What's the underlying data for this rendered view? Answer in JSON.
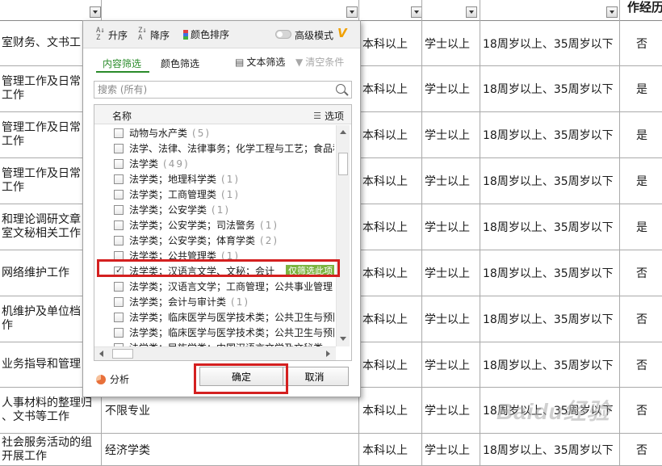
{
  "sheet": {
    "header_right": "作经历",
    "rows": [
      {
        "a": "室财务、文书工",
        "d": "本科以上",
        "e": "学士以上",
        "f": "18周岁以上、35周岁以下",
        "g": "否"
      },
      {
        "a": "管理工作及日常\n工作",
        "d": "本科以上",
        "e": "学士以上",
        "f": "18周岁以上、35周岁以下",
        "g": "是"
      },
      {
        "a": "管理工作及日常\n工作",
        "d": "本科以上",
        "e": "学士以上",
        "f": "18周岁以上、35周岁以下",
        "g": "是"
      },
      {
        "a": "管理工作及日常\n工作",
        "d": "本科以上",
        "e": "学士以上",
        "f": "18周岁以上、35周岁以下",
        "g": "是"
      },
      {
        "a": "和理论调研文章\n室文秘相关工作",
        "d": "本科以上",
        "e": "学士以上",
        "f": "18周岁以上、35周岁以下",
        "g": "是"
      },
      {
        "a": "网络维护工作",
        "d": "本科以上",
        "e": "学士以上",
        "f": "18周岁以上、35周岁以下",
        "g": "否"
      },
      {
        "a": "机维护及单位档\n作",
        "d": "本科以上",
        "e": "学士以上",
        "f": "18周岁以上、35周岁以下",
        "g": "否"
      },
      {
        "a": "业务指导和管理",
        "d": "本科以上",
        "e": "学士以上",
        "f": "18周岁以上、35周岁以下",
        "g": "否"
      },
      {
        "a": "人事材料的整理归\n、文书等工作",
        "b": "不限专业",
        "d": "本科以上",
        "e": "学士以上",
        "f": "18周岁以上、35周岁以下",
        "g": "否"
      },
      {
        "a": "社会服务活动的组\n开展工作",
        "b": "经济学类",
        "d": "本科以上",
        "e": "学士以上",
        "f": "18周岁以上、35周岁以下",
        "g": "否"
      }
    ]
  },
  "watermark": "Baidu经验",
  "filter": {
    "sort_asc": "升序",
    "sort_desc": "降序",
    "color_sort": "颜色排序",
    "advanced_mode": "高级模式",
    "vip_badge": "V",
    "tab_content": "内容筛选",
    "tab_color": "颜色筛选",
    "text_filter": "文本筛选",
    "clear_conditions": "清空条件",
    "search_placeholder": "搜索 (所有)",
    "list_header_name": "名称",
    "list_header_options": "选项",
    "only_filter_tag": "仅筛选此项",
    "items": [
      {
        "label": "动物与水产类",
        "count": "(5)",
        "checked": false
      },
      {
        "label": "法学、法律、法律事务；化学工程与工艺；食品科",
        "count": "",
        "checked": false
      },
      {
        "label": "法学类",
        "count": "(49)",
        "checked": false
      },
      {
        "label": "法学类；地理科学类",
        "count": "(1)",
        "checked": false
      },
      {
        "label": "法学类；工商管理类",
        "count": "(1)",
        "checked": false
      },
      {
        "label": "法学类；公安学类",
        "count": "(1)",
        "checked": false
      },
      {
        "label": "法学类；公安学类；司法警务",
        "count": "(1)",
        "checked": false
      },
      {
        "label": "法学类；公安学类；体育学类",
        "count": "(2)",
        "checked": false
      },
      {
        "label": "法学类；公共管理类",
        "count": "(1)",
        "checked": false
      },
      {
        "label": "法学类；汉语言文学、文秘；会计",
        "count": "",
        "checked": true
      },
      {
        "label": "法学类；汉语言文学；工商管理；公共事业管理",
        "count": "",
        "checked": false
      },
      {
        "label": "法学类；会计与审计类",
        "count": "(1)",
        "checked": false
      },
      {
        "label": "法学类；临床医学与医学技术类；公共卫生与预防",
        "count": "",
        "checked": false
      },
      {
        "label": "法学类；临床医学与医学技术类；公共卫生与预防",
        "count": "",
        "checked": false
      },
      {
        "label": "法学类；民族学类；中国汉语言文学及文秘类",
        "count": "",
        "checked": false
      }
    ],
    "analyze": "分析",
    "ok": "确定",
    "cancel": "取消"
  }
}
